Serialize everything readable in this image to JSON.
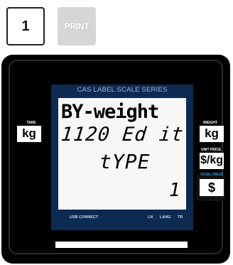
{
  "keys": {
    "key1_label": "1",
    "print_label": "PRINT"
  },
  "display": {
    "caption": "CAS LABEL SCALE SERIES",
    "line1": "BY-weight",
    "line2": "1120 Ed it",
    "line3": "tYPE",
    "line4": "1",
    "footer": {
      "usb": "USB CONNECT",
      "ln": "LN",
      "lang": "LANG",
      "tr": "TR"
    }
  },
  "sides": {
    "tare": {
      "label": "TARE",
      "unit": "kg"
    },
    "weight": {
      "label": "WEIGHT",
      "unit": "kg"
    },
    "unit_price": {
      "label": "UNIT PRICE",
      "unit": "$/kg"
    },
    "total_price": {
      "label": "TOTAL PRICE",
      "unit": "$"
    }
  },
  "colors": {
    "lcd_frame": "#0c2a52",
    "total_label": "#27a3e3",
    "print_key": "#d6d6d6"
  }
}
